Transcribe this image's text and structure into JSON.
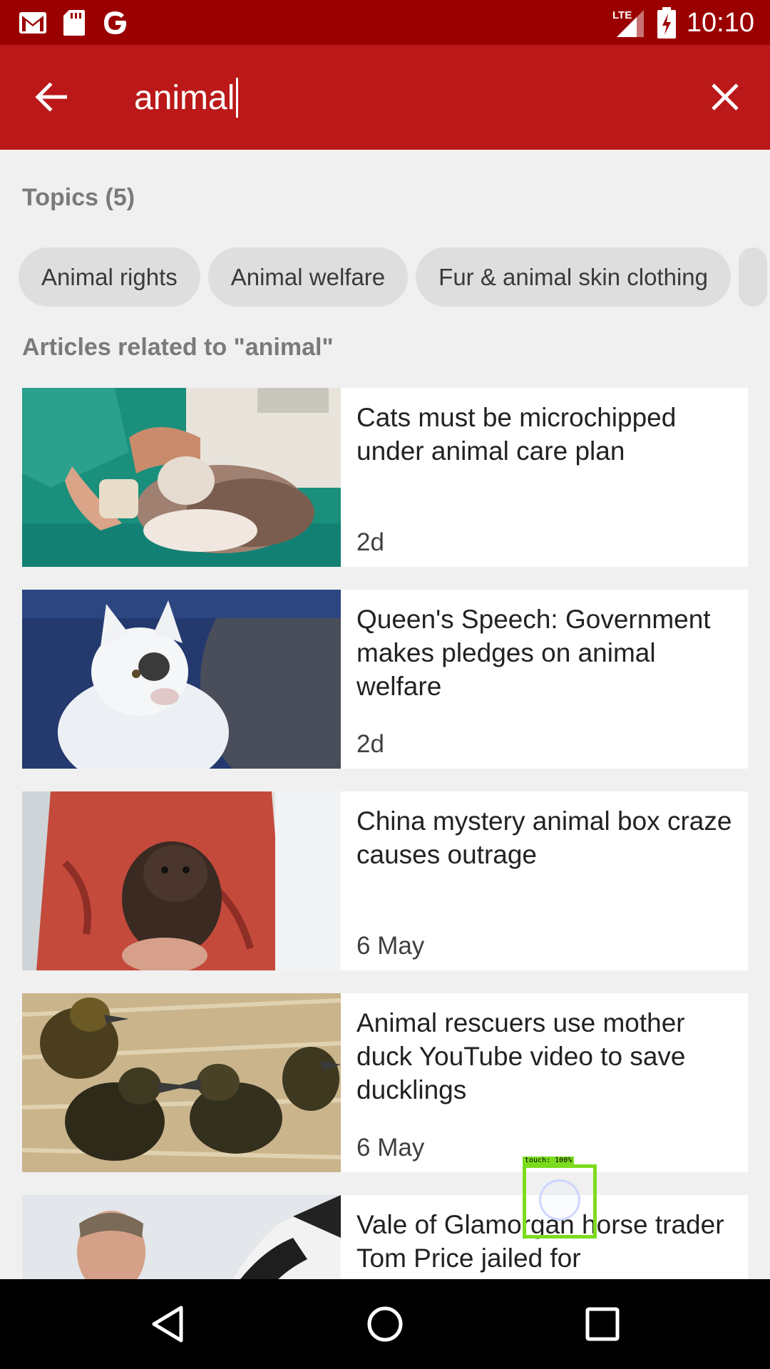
{
  "status_bar": {
    "time": "10:10",
    "network": "LTE",
    "icons": [
      "gmail-icon",
      "sd-card-icon",
      "google-icon",
      "signal-icon",
      "battery-charging-icon"
    ]
  },
  "search": {
    "query": "animal",
    "back_icon": "arrow-left-icon",
    "clear_icon": "close-icon"
  },
  "topics": {
    "header": "Topics (5)",
    "chips": [
      "Animal rights",
      "Animal welfare",
      "Fur & animal skin clothing"
    ]
  },
  "articles": {
    "header": "Articles related to \"animal\"",
    "items": [
      {
        "title": "Cats must be microchipped under animal care plan",
        "date": "2d"
      },
      {
        "title": "Queen's Speech: Government makes pledges on animal welfare",
        "date": "2d"
      },
      {
        "title": "China mystery animal box craze causes outrage",
        "date": "6 May"
      },
      {
        "title": "Animal rescuers use mother duck YouTube video to save ducklings",
        "date": "6 May"
      },
      {
        "title": "Vale of Glamorgan horse trader Tom Price jailed for",
        "date": ""
      }
    ]
  },
  "touch_overlay": {
    "label": "touch: 100%"
  },
  "colors": {
    "status_bar": "#9b0000",
    "app_bar": "#bb1919",
    "background": "#f0f0f0"
  }
}
